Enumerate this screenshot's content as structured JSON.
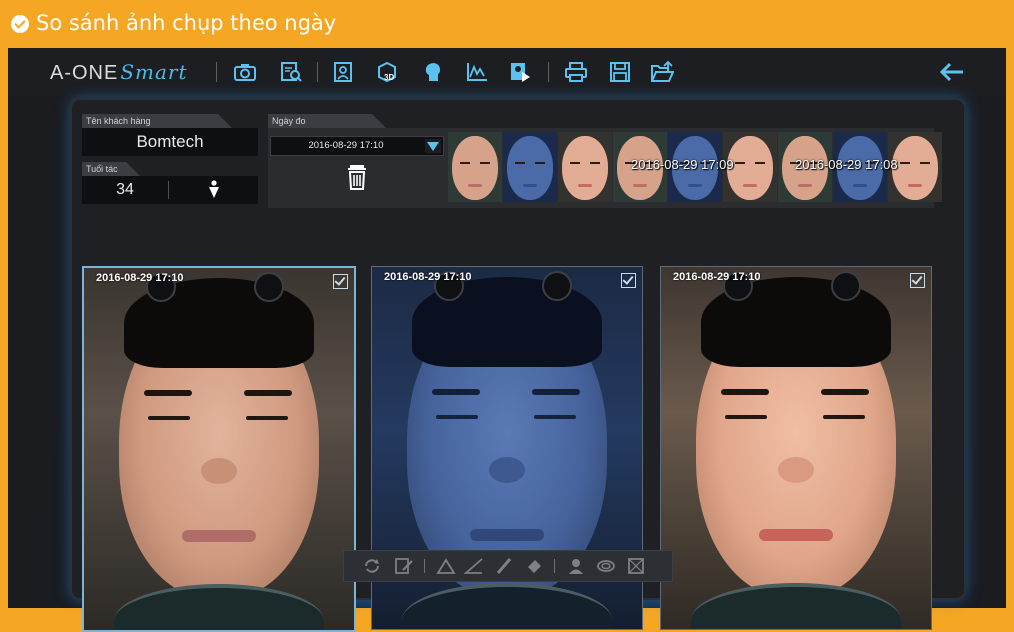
{
  "banner": {
    "title": "So sánh ảnh chụp theo ngày"
  },
  "app": {
    "logo": {
      "brand": "A-ONE",
      "sub": "Smart"
    },
    "toolbar_icons": [
      "camera-icon",
      "search-report-icon",
      "profile-icon",
      "3d-face-icon",
      "face-profile-icon",
      "graph-icon",
      "video-icon",
      "print-icon",
      "save-icon",
      "open-folder-icon"
    ],
    "back_icon": "back-arrow-icon"
  },
  "customer": {
    "name_label": "Tên khách hàng",
    "name_value": "Bomtech",
    "age_label": "Tuổi tác",
    "age_value": "34",
    "gender_icon": "male-icon"
  },
  "measure": {
    "date_label": "Ngày đo",
    "date_selected": "2016-08-29 17:10",
    "delete_icon": "trash-icon"
  },
  "thumbnails": {
    "groups": [
      {
        "date": "",
        "tones": [
          "normal",
          "uv",
          "warm"
        ]
      },
      {
        "date": "2016-08-29 17:09",
        "tones": [
          "normal",
          "uv",
          "warm"
        ]
      },
      {
        "date": "2016-08-29 17:08",
        "tones": [
          "normal",
          "uv",
          "warm"
        ]
      }
    ]
  },
  "photos": [
    {
      "timestamp": "2016-08-29 17:10",
      "mode": "normal",
      "checked": true
    },
    {
      "timestamp": "2016-08-29 17:10",
      "mode": "uv",
      "checked": true
    },
    {
      "timestamp": "2016-08-29 17:10",
      "mode": "warm",
      "checked": true
    }
  ],
  "colors": {
    "banner": "#f5a623",
    "accent": "#4fb8e8",
    "panel_glow": "#2a8ad2"
  }
}
